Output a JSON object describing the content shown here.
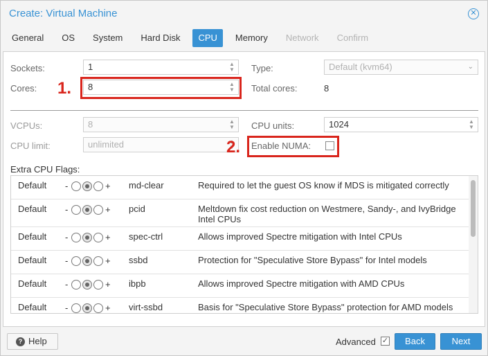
{
  "window": {
    "title": "Create: Virtual Machine"
  },
  "tabs": [
    {
      "label": "General",
      "state": "normal"
    },
    {
      "label": "OS",
      "state": "normal"
    },
    {
      "label": "System",
      "state": "normal"
    },
    {
      "label": "Hard Disk",
      "state": "normal"
    },
    {
      "label": "CPU",
      "state": "active"
    },
    {
      "label": "Memory",
      "state": "normal"
    },
    {
      "label": "Network",
      "state": "disabled"
    },
    {
      "label": "Confirm",
      "state": "disabled"
    }
  ],
  "cpu": {
    "sockets_label": "Sockets:",
    "sockets_value": "1",
    "cores_label": "Cores:",
    "cores_value": "8",
    "type_label": "Type:",
    "type_value": "Default (kvm64)",
    "total_cores_label": "Total cores:",
    "total_cores_value": "8",
    "vcpus_label": "VCPUs:",
    "vcpus_value": "8",
    "cpu_units_label": "CPU units:",
    "cpu_units_value": "1024",
    "cpu_limit_label": "CPU limit:",
    "cpu_limit_placeholder": "unlimited",
    "numa_label": "Enable NUMA:",
    "numa_checked": false
  },
  "annotations": {
    "marker1": "1.",
    "marker2": "2.",
    "highlight_color": "#d9251c"
  },
  "flags": {
    "heading": "Extra CPU Flags:",
    "minus": "-",
    "plus": "+",
    "rows": [
      {
        "default": "Default",
        "name": "md-clear",
        "desc": "Required to let the guest OS know if MDS is mitigated correctly"
      },
      {
        "default": "Default",
        "name": "pcid",
        "desc": "Meltdown fix cost reduction on Westmere, Sandy-, and IvyBridge Intel CPUs"
      },
      {
        "default": "Default",
        "name": "spec-ctrl",
        "desc": "Allows improved Spectre mitigation with Intel CPUs"
      },
      {
        "default": "Default",
        "name": "ssbd",
        "desc": "Protection for \"Speculative Store Bypass\" for Intel models"
      },
      {
        "default": "Default",
        "name": "ibpb",
        "desc": "Allows improved Spectre mitigation with AMD CPUs"
      },
      {
        "default": "Default",
        "name": "virt-ssbd",
        "desc": "Basis for \"Speculative Store Bypass\" protection for AMD models"
      }
    ]
  },
  "footer": {
    "help_label": "Help",
    "advanced_label": "Advanced",
    "advanced_checked": true,
    "back_label": "Back",
    "next_label": "Next"
  },
  "colors": {
    "accent": "#3892d4"
  }
}
